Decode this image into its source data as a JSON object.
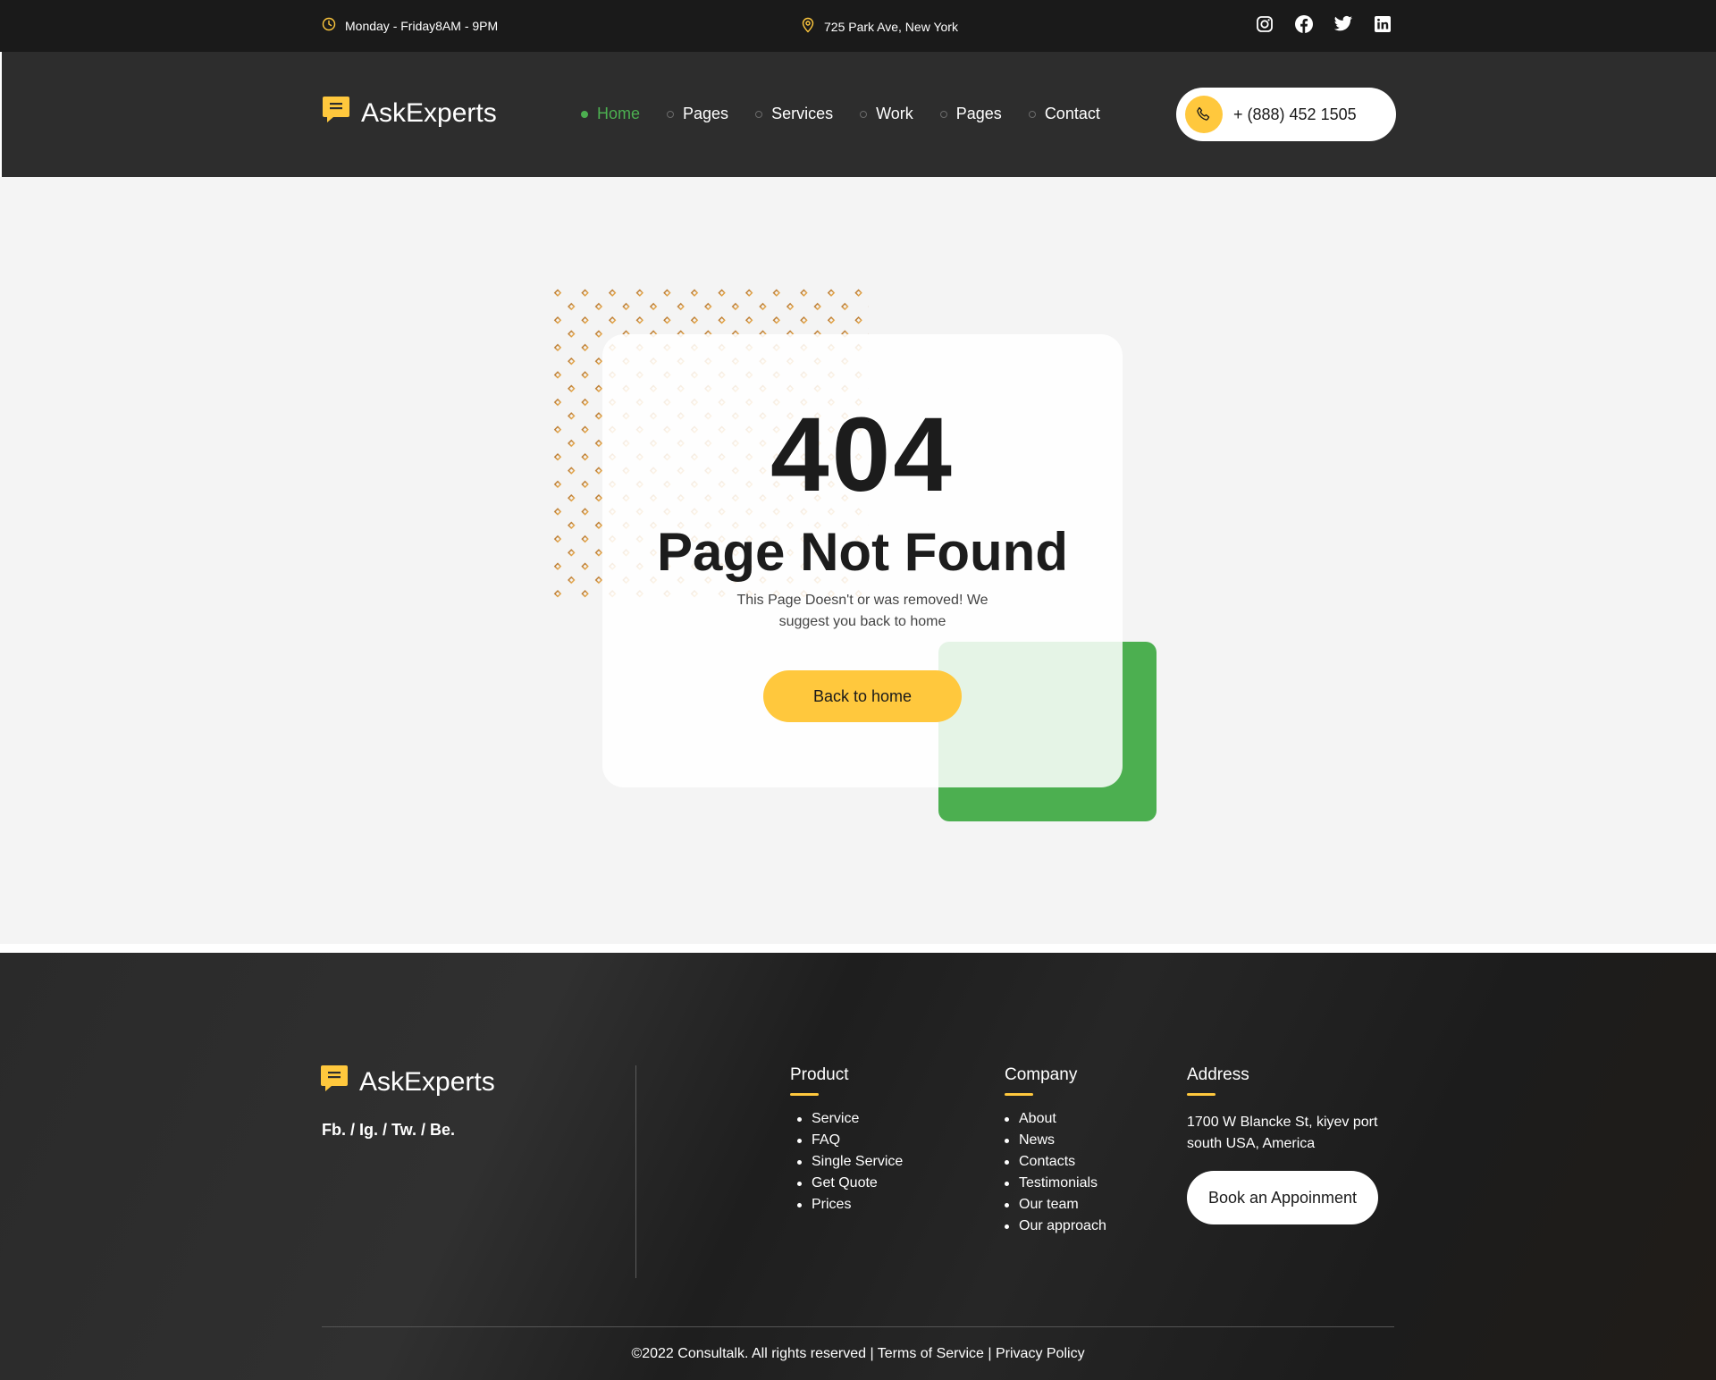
{
  "topbar": {
    "hours": "Monday - Friday8AM - 9PM",
    "address": "725 Park Ave, New York",
    "socials": [
      "instagram-icon",
      "facebook-icon",
      "twitter-icon",
      "linkedin-icon"
    ]
  },
  "brand": {
    "name": "AskExperts",
    "accent": "#ffc83d",
    "green": "#4caf50"
  },
  "nav": {
    "items": [
      {
        "label": "Home",
        "active": true
      },
      {
        "label": "Pages"
      },
      {
        "label": "Services"
      },
      {
        "label": "Work"
      },
      {
        "label": "Pages"
      },
      {
        "label": "Contact"
      }
    ]
  },
  "header": {
    "phone": "+ (888) 452 1505"
  },
  "error": {
    "code": "404",
    "title": "Page Not Found",
    "description": "This Page Doesn't or was removed! We suggest you back to home",
    "button": "Back to home"
  },
  "footer": {
    "socials": "Fb. / Ig.  / Tw.  / Be.",
    "product": {
      "title": "Product",
      "items": [
        "Service",
        "FAQ",
        "Single Service",
        "Get Quote",
        "Prices"
      ]
    },
    "company": {
      "title": "Company",
      "items": [
        "About",
        "News",
        "Contacts",
        "Testimonials",
        "Our team",
        "Our approach"
      ]
    },
    "address": {
      "title": "Address",
      "text": "1700 W Blancke St, kiyev  port south USA, America",
      "button": "Book an Appoinment"
    },
    "copyright": {
      "text": "©2022 Consultalk. All rights reserved |",
      "terms": "Terms of Service",
      "separator": "|",
      "privacy": "Privacy Policy"
    }
  }
}
